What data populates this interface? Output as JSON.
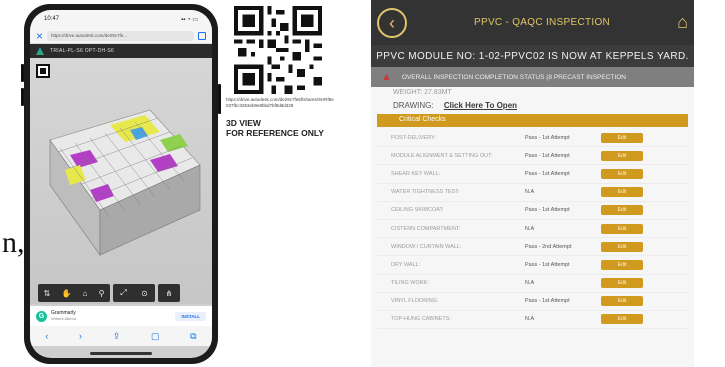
{
  "slide_fragment": "n,",
  "phone": {
    "status_time": "10:47",
    "status_icons": "▪▪ ◔ ▭",
    "url": "https://drive.autodesk.com/de29c7fe...",
    "close_icon": "close-icon",
    "app_title": "TRIAL-PL-S6 OPT-DH-S6",
    "toolbar_icons": [
      "⇅",
      "✋",
      "⌂",
      "⚲",
      "⤢",
      "⊙",
      "⋔"
    ],
    "grammarly_title": "Grammarly",
    "grammarly_sub": "Writers Attend",
    "install_label": "INSTALL",
    "nav_icons": [
      "‹",
      "›",
      "⇪",
      "▢",
      "⧉"
    ]
  },
  "qr": {
    "url": "https://drive.autodesk.com/de29c7fe5f/shares/SHRf8e037fbc3263eb9e8bbd7bf8d8d328",
    "caption_line1": "3D VIEW",
    "caption_line2": "FOR REFERENCE ONLY"
  },
  "app": {
    "title": "PPVC - QAQC INSPECTION",
    "back_icon": "back-icon",
    "home_icon": "home-icon",
    "module_status": "PPVC MODULE NO: 1-02-PPVC02 IS NOW AT KEPPELS YARD.",
    "alert": "OVERALL INSPECTION COMPLETION STATUS (8 PRECAST INSPECTION",
    "weight": "WEIGHT: 27.83MT",
    "drawing_label": "DRAWING:",
    "drawing_link": "Click Here To Open",
    "section": "Critical Checks",
    "edit_label": "Edit",
    "checks": [
      {
        "label": "POST-DELIVERY:",
        "result": "Pass - 1st Attempt"
      },
      {
        "label": "MODULE ALIGNMENT & SETTING OUT:",
        "result": "Pass - 1st Attempt"
      },
      {
        "label": "SHEAR KEY WALL:",
        "result": "Pass - 1st Attempt"
      },
      {
        "label": "WATER TIGHTNESS TEST:",
        "result": "N.A"
      },
      {
        "label": "CEILING SKIMCOAT:",
        "result": "Pass - 1st Attempt"
      },
      {
        "label": "CISTERN COMPARTMENT:",
        "result": "N.A"
      },
      {
        "label": "WINDOW / CURTAIN WALL:",
        "result": "Pass - 2nd Attempt"
      },
      {
        "label": "DRY WALL:",
        "result": "Pass - 1st Attempt"
      },
      {
        "label": "TILING WORK:",
        "result": "N.A"
      },
      {
        "label": "VINYL FLOORING:",
        "result": "Pass - 1st Attempt"
      },
      {
        "label": "TOP-HUNG CABINETS:",
        "result": "N.A"
      }
    ]
  },
  "colors": {
    "accent": "#cf9a1e",
    "header": "#333333",
    "alert_bg": "#7f7f7f"
  }
}
